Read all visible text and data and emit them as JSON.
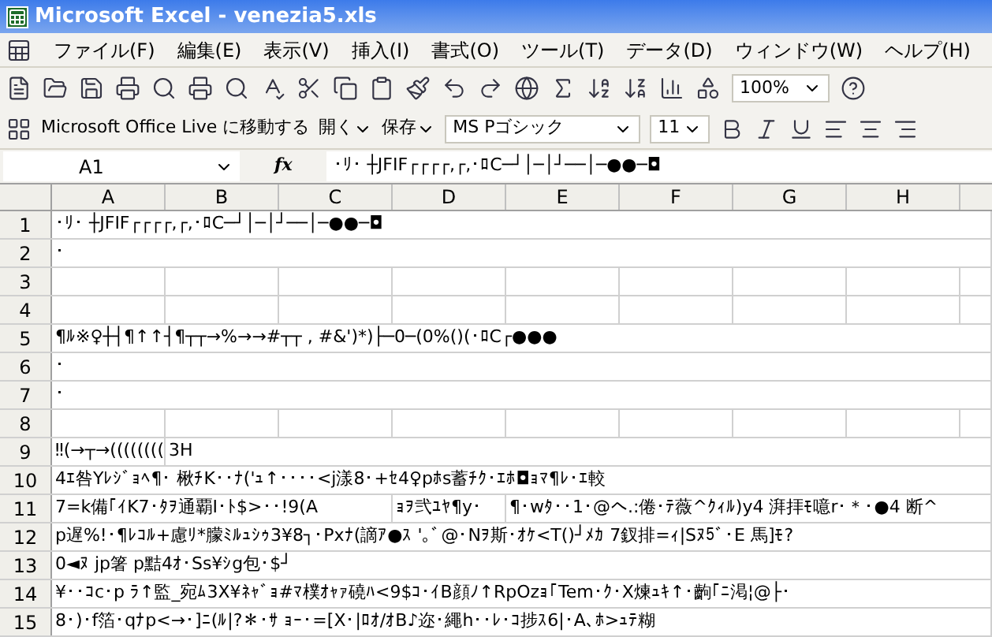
{
  "window": {
    "title": "Microsoft Excel - venezia5.xls"
  },
  "menu": [
    "ファイル(F)",
    "編集(E)",
    "表示(V)",
    "挿入(I)",
    "書式(O)",
    "ツール(T)",
    "データ(D)",
    "ウィンドウ(W)",
    "ヘルプ(H)"
  ],
  "standard_toolbar": {
    "zoom": "100%"
  },
  "formatting_toolbar": {
    "office_live": "Microsoft Office Live に移動する",
    "open": "開く",
    "save": "保存",
    "font": "MS Pゴシック",
    "font_size": "11"
  },
  "formula_bar": {
    "name_box": "A1",
    "fx": "fx",
    "content": "･ﾘ･ ┼JFIF┌┌┌┌,┌,･ﾛC─┘│─│┘──│─●●─◘"
  },
  "columns": [
    "A",
    "B",
    "C",
    "D",
    "E",
    "F",
    "G",
    "H"
  ],
  "rows": [
    {
      "number": "1",
      "cells": {
        "A": "･ﾘ･ ┼JFIF┌┌┌┌,┌,･ﾛC─┘│─│┘──│─●●─◘"
      }
    },
    {
      "number": "2",
      "cells": {
        "A": "･"
      }
    },
    {
      "number": "3"
    },
    {
      "number": "4"
    },
    {
      "number": "5",
      "cells": {
        "A": "¶ﾙ※♀┼┤¶↑↑┤¶┬┬→%→→#┬┬ , #&')*)├─0─(0%()(･ﾛC┌●●●"
      }
    },
    {
      "number": "6",
      "cells": {
        "A": "･"
      }
    },
    {
      "number": "7",
      "cells": {
        "A": "･"
      }
    },
    {
      "number": "8"
    },
    {
      "number": "9",
      "cells": {
        "A": "‼(→┬→((((((((",
        "B": "3H"
      }
    },
    {
      "number": "10",
      "cells": {
        "A": "4ｴ咎Yﾚｼﾞｮﾍ¶･ 楸ﾁK･･ﾅ('ｭ↑････<j漾8･+ｾ4♀pﾎs蓄ﾁｸ･ｴﾎ◘ｮﾏ¶ﾚ･ｴ較"
      }
    },
    {
      "number": "11",
      "cells": {
        "A": "7=k備｢ｲK7･ﾀｦ通覇I･ﾄ$>･･!9(A",
        "D": "ｮｦ弐ﾕﾔ¶y･",
        "E": "¶･wﾀ･･1･@へ.:倦･ﾃ薇^ｸｨﾙ)y4 湃拝ﾓ噫r･＊･●4 断^"
      }
    },
    {
      "number": "12",
      "cells": {
        "A": "p遅%!･¶ﾚｺﾙ+慮ﾘ*朦ﾐﾙｭｼｩ3¥8┐･Pxﾅ(謫ｱ●ｽ '｡ﾞ@･Nｦ斯･ｵｹ<T()┘ﾒｶ 7釵排=ｨ|Sﾇ5ﾞ･E 馬]ﾓ?"
      }
    },
    {
      "number": "13",
      "cells": {
        "A": "0◄ﾇ jp箸 p黠4ｵ･Ss¥ｼg包･$┘"
      }
    },
    {
      "number": "14",
      "cells": {
        "A": "¥･･ｺc･p ﾗ↑監_宛ﾑ3X¥ﾈｬﾞｮ#ﾏ樸ｵｬｧ磽ﾊ<9$ｺ･ｲB顔ﾉ↑RpOzｮ｢Tem･ｸ･X煉ｭｷ↑･齣｢ﾆ渇¦@├･"
      }
    },
    {
      "number": "15",
      "cells": {
        "A": "8･)･f箔･qﾅp<→･]ﾆ(ﾙ|?＊･ｻ ｮｰ･=[X･|ﾛｵ/ｵB♪迩･繩h･･ﾚ･ｺ捗ｽ6|･A､ﾎ>ｭﾃ糊"
      }
    }
  ]
}
